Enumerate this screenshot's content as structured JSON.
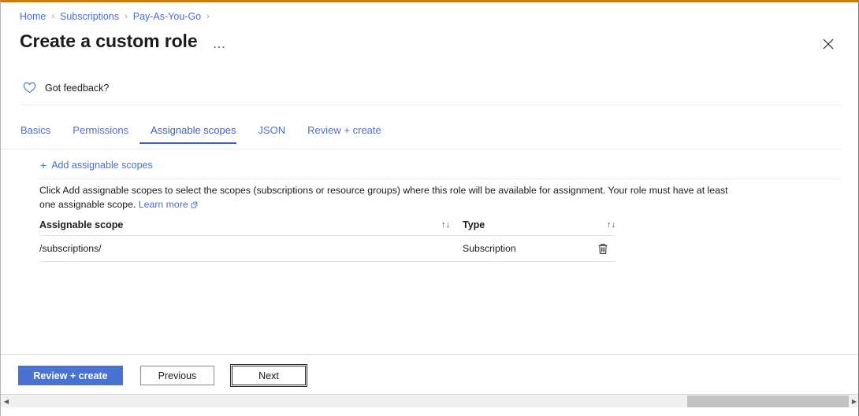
{
  "breadcrumb": {
    "items": [
      {
        "label": "Home"
      },
      {
        "label": "Subscriptions"
      },
      {
        "label": "Pay-As-You-Go"
      }
    ],
    "separator": "›"
  },
  "header": {
    "title": "Create a custom role",
    "more_options": "…",
    "close_icon": "close-icon"
  },
  "feedback": {
    "label": "Got feedback?",
    "icon": "heart-icon"
  },
  "tabs": [
    {
      "label": "Basics",
      "selected": false
    },
    {
      "label": "Permissions",
      "selected": false
    },
    {
      "label": "Assignable scopes",
      "selected": true
    },
    {
      "label": "JSON",
      "selected": false
    },
    {
      "label": "Review + create",
      "selected": false
    }
  ],
  "command_bar": {
    "add_scope": {
      "label": "Add assignable scopes",
      "plus": "+"
    }
  },
  "description": {
    "text": "Click Add assignable scopes to select the scopes (subscriptions or resource groups) where this role will be available for assignment. Your role must have at least one assignable scope.",
    "link_label": "Learn more",
    "link_icon": "external-link-icon"
  },
  "table": {
    "columns": [
      {
        "label": "Assignable scope",
        "sort_icon": "↑↓"
      },
      {
        "label": "Type",
        "sort_icon": "↑↓"
      }
    ],
    "rows": [
      {
        "scope": "/subscriptions/",
        "type": "Subscription",
        "action_icon": "delete-icon"
      }
    ]
  },
  "footer": {
    "buttons": [
      {
        "label": "Review + create",
        "style": "primary"
      },
      {
        "label": "Previous",
        "style": "secondary"
      },
      {
        "label": "Next",
        "style": "focused"
      }
    ]
  },
  "scrollbar": {
    "left_arrow": "◀",
    "right_arrow": "▶"
  },
  "colors": {
    "accent_blue": "#4a72d0",
    "link_blue": "#4a6fd4",
    "tab_selected": "#3b5fc4",
    "top_border_orange": "#c67d12",
    "text_primary": "#1b1b1b",
    "scrollbar_thumb": "#c2c2c2"
  }
}
